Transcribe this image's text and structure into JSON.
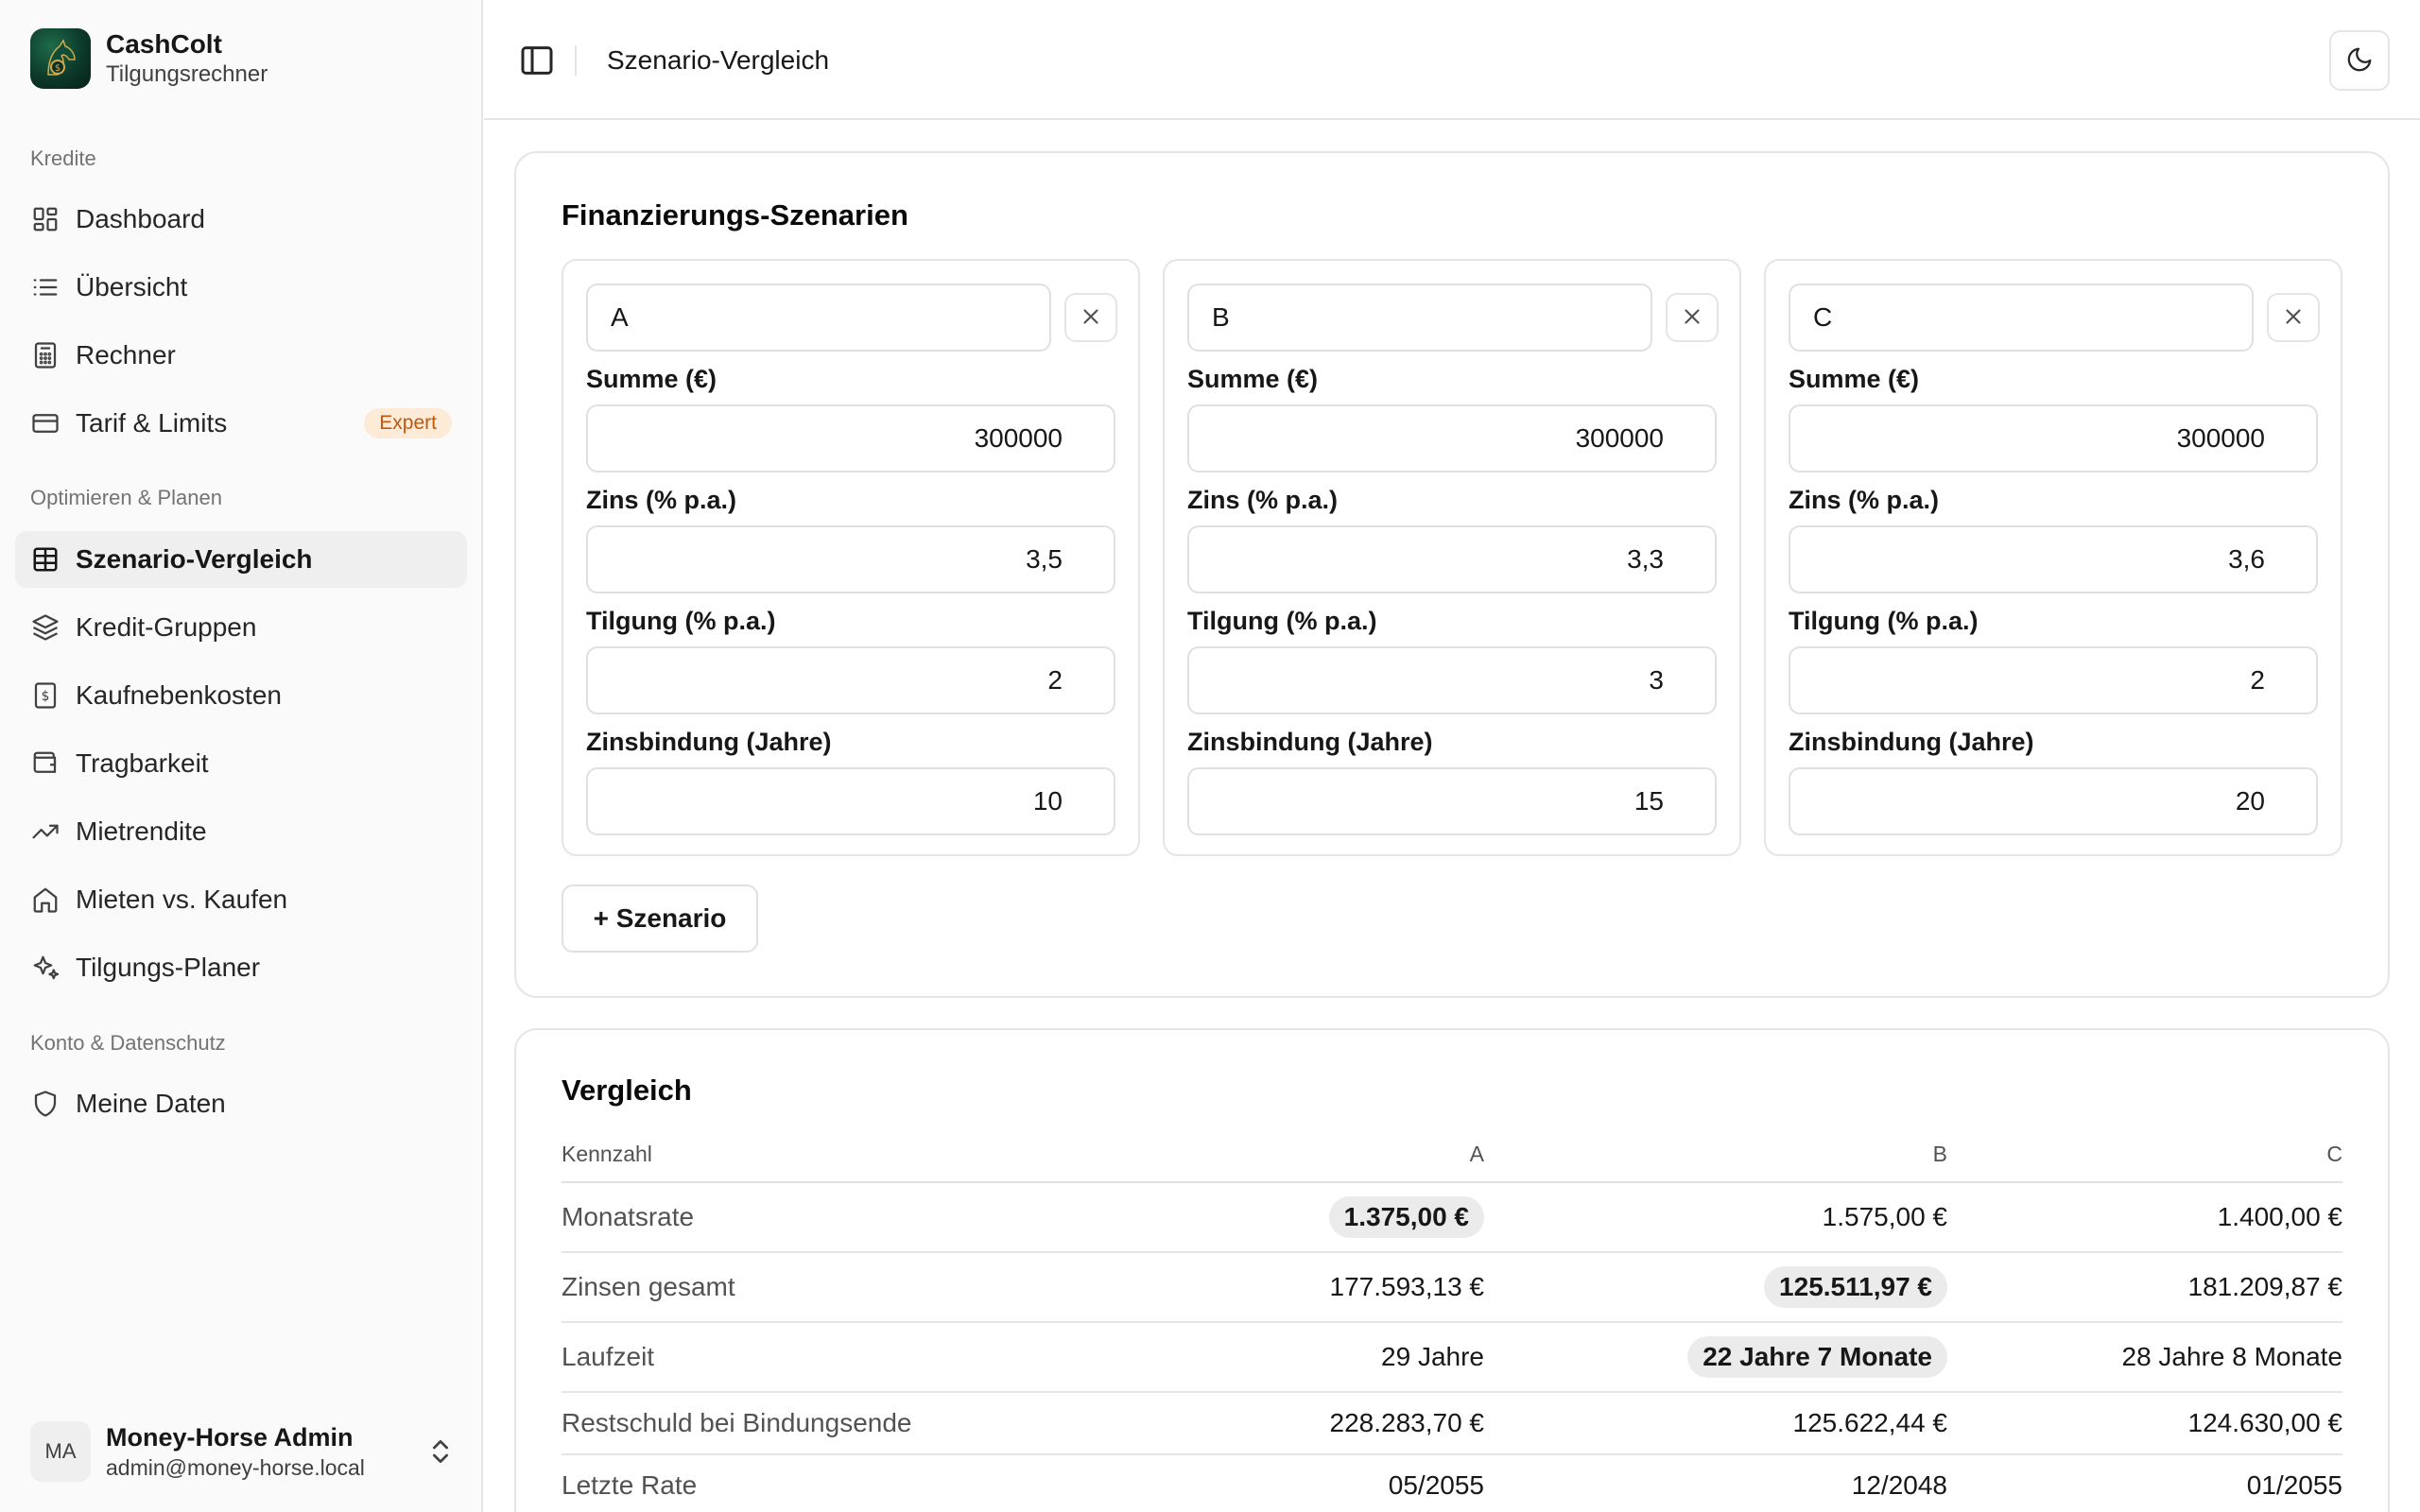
{
  "brand": {
    "name": "CashColt",
    "subtitle": "Tilgungsrechner"
  },
  "sidebar": {
    "groups": [
      {
        "label": "Kredite"
      },
      {
        "label": "Optimieren & Planen"
      },
      {
        "label": "Konto & Datenschutz"
      }
    ],
    "items": [
      {
        "label": "Dashboard",
        "icon": "dashboard-icon"
      },
      {
        "label": "Übersicht",
        "icon": "list-icon"
      },
      {
        "label": "Rechner",
        "icon": "calculator-icon"
      },
      {
        "label": "Tarif & Limits",
        "icon": "credit-card-icon",
        "badge": "Expert"
      },
      {
        "label": "Szenario-Vergleich",
        "icon": "table-icon",
        "active": true
      },
      {
        "label": "Kredit-Gruppen",
        "icon": "layers-icon"
      },
      {
        "label": "Kaufnebenkosten",
        "icon": "receipt-icon"
      },
      {
        "label": "Tragbarkeit",
        "icon": "wallet-icon"
      },
      {
        "label": "Mietrendite",
        "icon": "trending-up-icon"
      },
      {
        "label": "Mieten vs. Kaufen",
        "icon": "home-icon"
      },
      {
        "label": "Tilgungs-Planer",
        "icon": "sparkles-icon"
      },
      {
        "label": "Meine Daten",
        "icon": "shield-icon"
      }
    ]
  },
  "user": {
    "initials": "MA",
    "name": "Money-Horse Admin",
    "email": "admin@money-horse.local"
  },
  "header": {
    "title": "Szenario-Vergleich"
  },
  "scenarios_card": {
    "title": "Finanzierungs-Szenarien",
    "labels": {
      "amount": "Summe (€)",
      "rate": "Zins (% p.a.)",
      "repayment": "Tilgung (% p.a.)",
      "fixed": "Zinsbindung (Jahre)"
    },
    "scenarios": [
      {
        "name": "A",
        "amount": "300000",
        "rate": "3,5",
        "repayment": "2",
        "fixed": "10"
      },
      {
        "name": "B",
        "amount": "300000",
        "rate": "3,3",
        "repayment": "3",
        "fixed": "15"
      },
      {
        "name": "C",
        "amount": "300000",
        "rate": "3,6",
        "repayment": "2",
        "fixed": "20"
      }
    ],
    "add_label": "+ Szenario"
  },
  "comparison": {
    "title": "Vergleich",
    "headers": [
      "Kennzahl",
      "A",
      "B",
      "C"
    ],
    "rows": [
      {
        "label": "Monatsrate",
        "values": [
          "1.375,00 €",
          "1.575,00 €",
          "1.400,00 €"
        ],
        "best": 0
      },
      {
        "label": "Zinsen gesamt",
        "values": [
          "177.593,13 €",
          "125.511,97 €",
          "181.209,87 €"
        ],
        "best": 1
      },
      {
        "label": "Laufzeit",
        "values": [
          "29 Jahre",
          "22 Jahre 7 Monate",
          "28 Jahre 8 Monate"
        ],
        "best": 1
      },
      {
        "label": "Restschuld bei Bindungsende",
        "values": [
          "228.283,70 €",
          "125.622,44 €",
          "124.630,00 €"
        ],
        "best": -1
      },
      {
        "label": "Letzte Rate",
        "values": [
          "05/2055",
          "12/2048",
          "01/2055"
        ],
        "best": -1
      }
    ]
  },
  "colors": {
    "accent_badge_bg": "#fdebd7",
    "accent_badge_text": "#c2570c",
    "best_highlight": "#ebebeb"
  }
}
